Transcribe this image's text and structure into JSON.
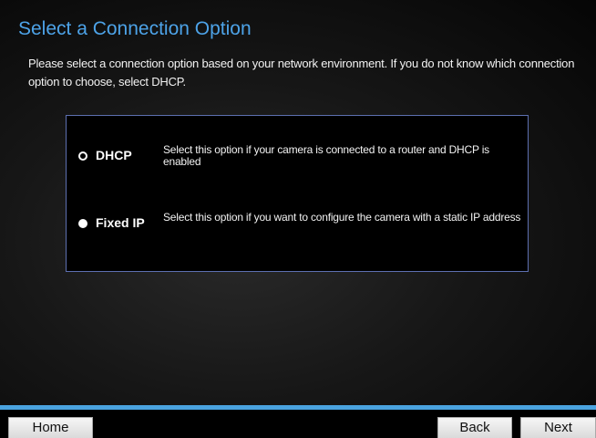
{
  "page": {
    "title": "Select a Connection Option",
    "intro": "Please select a connection option based on your network environment. If you do not know which connection option to choose, select DHCP."
  },
  "options": [
    {
      "label": "DHCP",
      "description": "Select this option if your camera is connected to a router and DHCP is enabled",
      "selected": false
    },
    {
      "label": "Fixed IP",
      "description": "Select this option if you want to configure the camera with a static IP address",
      "selected": true
    }
  ],
  "footer": {
    "home_label": "Home",
    "back_label": "Back",
    "next_label": "Next"
  },
  "colors": {
    "title": "#4da3e8",
    "accent_line": "#4aa3df",
    "box_border": "#5d6fb0"
  }
}
